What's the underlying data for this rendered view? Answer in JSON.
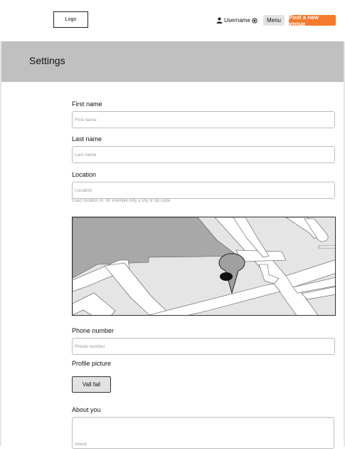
{
  "header": {
    "logo": "Logo",
    "username": "Username",
    "menu_label": "Menu",
    "post_label": "Post a new venue",
    "accent_color": "#f47a2d"
  },
  "banner": {
    "title": "Settings"
  },
  "form": {
    "first_name": {
      "label": "First name",
      "placeholder": "First name"
    },
    "last_name": {
      "label": "Last name",
      "placeholder": "Last name"
    },
    "location": {
      "label": "Location",
      "placeholder": "Location",
      "hint": "Exact location or, for example only a city or zip code."
    },
    "phone": {
      "label": "Phone number",
      "placeholder": "Phone number"
    },
    "profile_picture": {
      "label": "Profile picture",
      "button_label": "Vall fail"
    },
    "about": {
      "label": "About you",
      "placeholder": "About"
    }
  },
  "icons": [
    "user-icon",
    "gear-icon",
    "map-pin-icon"
  ]
}
